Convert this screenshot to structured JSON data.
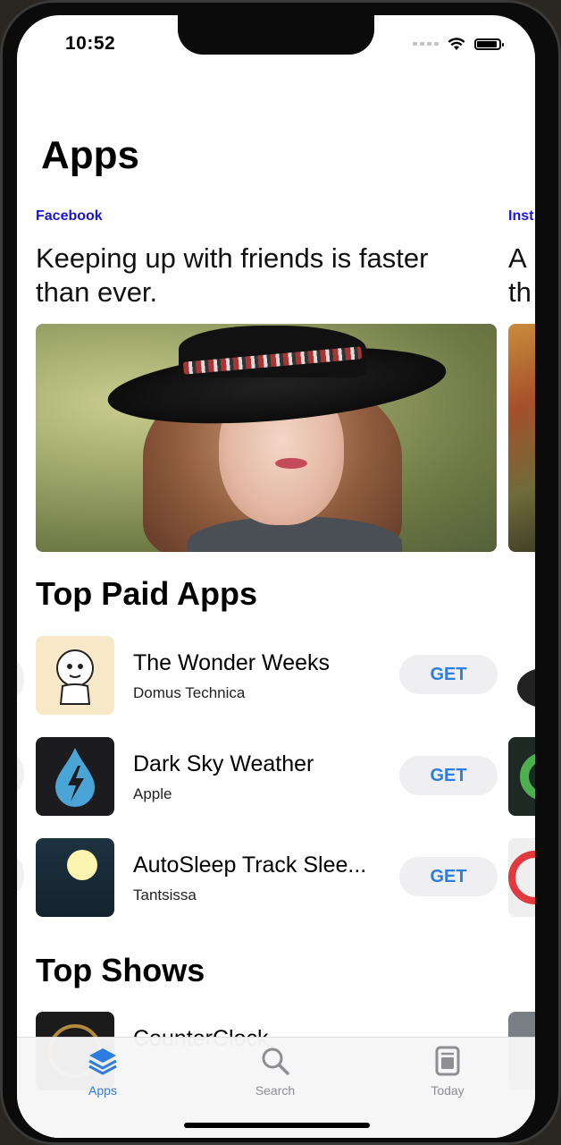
{
  "status_bar": {
    "time": "10:52"
  },
  "page": {
    "title": "Apps"
  },
  "featured": [
    {
      "eyebrow": "Facebook",
      "headline": "Keeping up with friends is faster than ever."
    },
    {
      "eyebrow": "Inst",
      "headline": "A th"
    }
  ],
  "top_paid": {
    "title": "Top Paid Apps",
    "apps": [
      {
        "name": "The Wonder Weeks",
        "developer": "Domus Technica",
        "action": "GET"
      },
      {
        "name": "Dark Sky Weather",
        "developer": "Apple",
        "action": "GET"
      },
      {
        "name": "AutoSleep Track Slee...",
        "developer": "Tantsissa",
        "action": "GET"
      }
    ]
  },
  "top_shows": {
    "title": "Top Shows",
    "apps": [
      {
        "name": "CounterClock"
      }
    ]
  },
  "tab_bar": {
    "tabs": [
      {
        "label": "Apps",
        "icon": "stack-icon",
        "active": true
      },
      {
        "label": "Search",
        "icon": "search-icon",
        "active": false
      },
      {
        "label": "Today",
        "icon": "today-icon",
        "active": false
      }
    ]
  },
  "colors": {
    "accent": "#2d7de0",
    "eyebrow": "#1a14d4",
    "inactive": "#8e8e93"
  }
}
